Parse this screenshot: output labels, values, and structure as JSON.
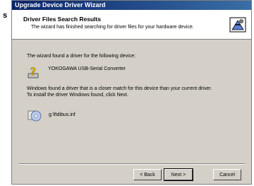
{
  "left_glyph": "s",
  "window": {
    "title": "Upgrade Device Driver Wizard"
  },
  "header": {
    "title": "Driver Files Search Results",
    "subtitle": "The wizard has finished searching for driver files for your hardware device.",
    "icon": "hardware-wizard-icon"
  },
  "body": {
    "found_text": "The wizard found a driver for the following device:",
    "device_name": "YOKOGAWA USB-Serial Converter",
    "device_icon": "question-mark-device-icon",
    "closer_match_line1": "Windows found a driver that is a closer match for this device than your current driver.",
    "closer_match_line2": "To install the driver Windows found, click Next.",
    "driver_file": "g:\\ftdibus.inf",
    "driver_icon": "cd-setup-icon"
  },
  "buttons": {
    "back": "< Back",
    "next": "Next >",
    "cancel": "Cancel"
  }
}
